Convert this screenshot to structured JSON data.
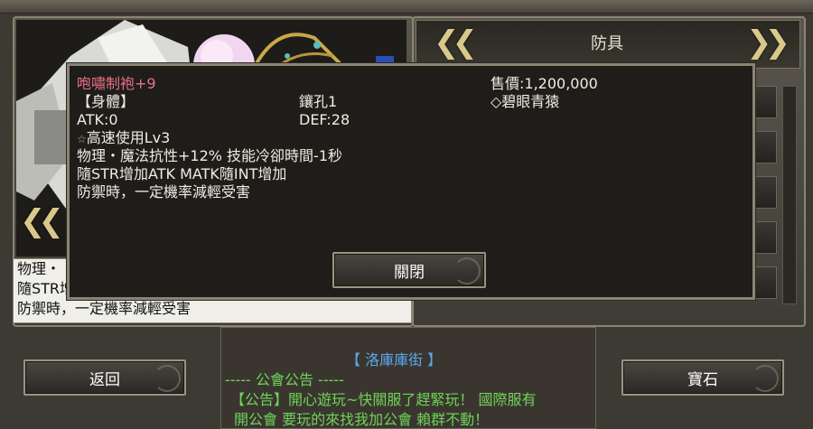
{
  "popup": {
    "item_name": "咆嘯制袍+9",
    "price": "售價:1,200,000",
    "type": "【身體】",
    "slots": "鑲孔1",
    "card": "◇碧眼青猿",
    "atk": "ATK:0",
    "def": "DEF:28",
    "skill": "高速使用Lv3",
    "effect1": "物理・魔法抗性+12% 技能冷卻時間-1秒",
    "effect2": "隨STR增加ATK MATK隨INT增加",
    "effect3": "防禦時，一定機率減輕受害",
    "close_label": "關閉"
  },
  "right_panel": {
    "title": "防具"
  },
  "info_behind": {
    "line1": "物理・",
    "line2": "隨STR增",
    "line3": "防禦時，一定機率減輕受害"
  },
  "buttons": {
    "back_label": "返回",
    "gem_label": "寶石"
  },
  "announcement": {
    "location": "【 洛庫庫街 】",
    "header": "----- 公會公告 -----",
    "line1": "【公告】開心遊玩~快關服了趕緊玩！ 國際服有",
    "line2": "開公會 要玩的來找我加公會 賴群不動！"
  },
  "colors": {
    "item_name": "#e8708a",
    "announce_green": "#6fd35a",
    "announce_blue": "#5aa8f0",
    "frame_gold": "#d8c98a"
  }
}
